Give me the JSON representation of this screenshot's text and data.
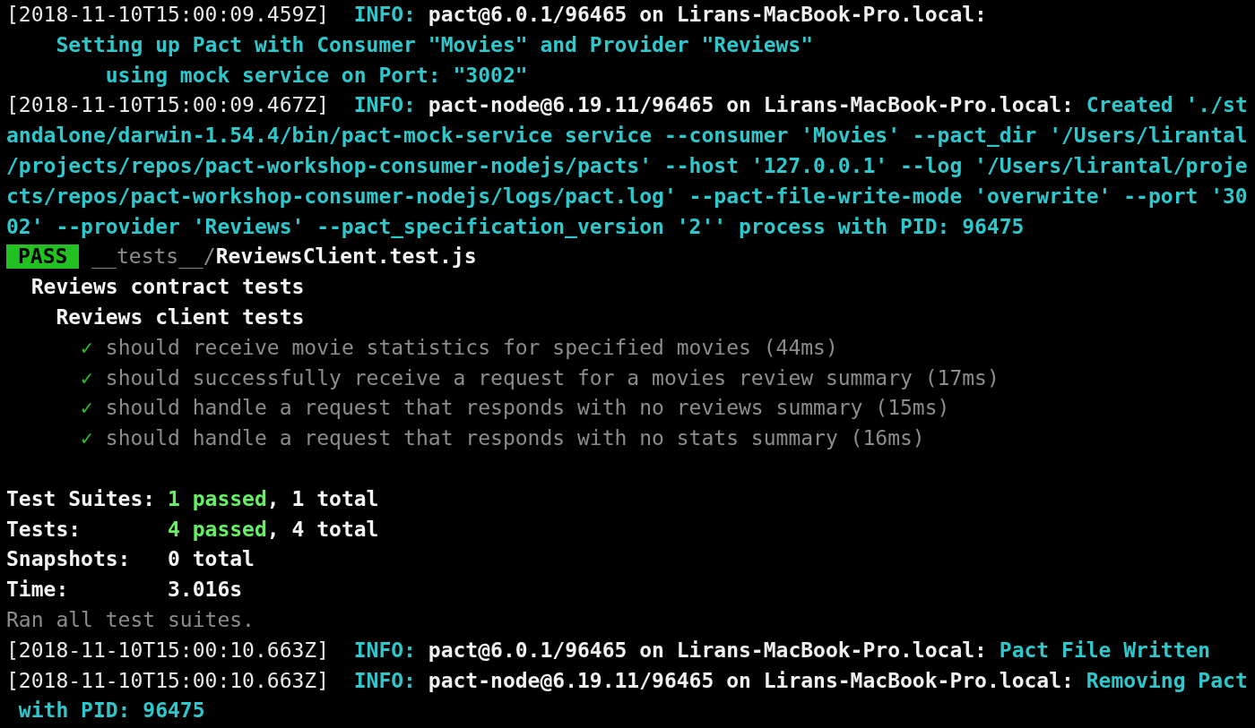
{
  "terminal": {
    "lines": [
      {
        "segments": [
          {
            "kind": "timestamp",
            "text": "[2018-11-10T15:00:09.459Z]"
          },
          {
            "kind": "level",
            "text": "  INFO:"
          },
          {
            "kind": "source",
            "text": " pact@6.0.1/96465 on Lirans-MacBook-Pro.local:"
          }
        ]
      },
      {
        "segments": [
          {
            "kind": "message",
            "text": "    Setting up Pact with Consumer \"Movies\" and Provider \"Reviews\""
          }
        ]
      },
      {
        "segments": [
          {
            "kind": "message",
            "text": "        using mock service on Port: \"3002\""
          }
        ]
      },
      {
        "segments": [
          {
            "kind": "timestamp",
            "text": "[2018-11-10T15:00:09.467Z]"
          },
          {
            "kind": "level",
            "text": "  INFO:"
          },
          {
            "kind": "source",
            "text": " pact-node@6.19.11/96465 on Lirans-MacBook-Pro.local:"
          },
          {
            "kind": "message",
            "text": " Created './st"
          }
        ]
      },
      {
        "segments": [
          {
            "kind": "message",
            "text": "andalone/darwin-1.54.4/bin/pact-mock-service service --consumer 'Movies' --pact_dir '/Users/lirantal"
          }
        ]
      },
      {
        "segments": [
          {
            "kind": "message",
            "text": "/projects/repos/pact-workshop-consumer-nodejs/pacts' --host '127.0.0.1' --log '/Users/lirantal/proje"
          }
        ]
      },
      {
        "segments": [
          {
            "kind": "message",
            "text": "cts/repos/pact-workshop-consumer-nodejs/logs/pact.log' --pact-file-write-mode 'overwrite' --port '30"
          }
        ]
      },
      {
        "segments": [
          {
            "kind": "message",
            "text": "02' --provider 'Reviews' --pact_specification_version '2'' process with PID: 96475"
          }
        ]
      },
      {
        "segments": [
          {
            "kind": "badge",
            "text": "PASS"
          },
          {
            "kind": "dim",
            "text": " __tests__/"
          },
          {
            "kind": "strong",
            "text": "ReviewsClient.test.js"
          }
        ]
      },
      {
        "segments": [
          {
            "kind": "strong",
            "text": "  Reviews contract tests"
          }
        ]
      },
      {
        "segments": [
          {
            "kind": "strong",
            "text": "    Reviews client tests"
          }
        ]
      },
      {
        "segments": [
          {
            "kind": "check",
            "text": "      ✓"
          },
          {
            "kind": "dim",
            "text": " should receive movie statistics for specified movies (44ms)"
          }
        ]
      },
      {
        "segments": [
          {
            "kind": "check",
            "text": "      ✓"
          },
          {
            "kind": "dim",
            "text": " should successfully receive a request for a movies review summary (17ms)"
          }
        ]
      },
      {
        "segments": [
          {
            "kind": "check",
            "text": "      ✓"
          },
          {
            "kind": "dim",
            "text": " should handle a request that responds with no reviews summary (15ms)"
          }
        ]
      },
      {
        "segments": [
          {
            "kind": "check",
            "text": "      ✓"
          },
          {
            "kind": "dim",
            "text": " should handle a request that responds with no stats summary (16ms)"
          }
        ]
      },
      {
        "gap_before": true,
        "segments": [
          {
            "kind": "strong",
            "text": "Test Suites: "
          },
          {
            "kind": "passed",
            "text": "1 passed"
          },
          {
            "kind": "strong",
            "text": ", 1 total"
          }
        ]
      },
      {
        "segments": [
          {
            "kind": "strong",
            "text": "Tests:       "
          },
          {
            "kind": "passed",
            "text": "4 passed"
          },
          {
            "kind": "strong",
            "text": ", 4 total"
          }
        ]
      },
      {
        "segments": [
          {
            "kind": "strong",
            "text": "Snapshots:   0 total"
          }
        ]
      },
      {
        "segments": [
          {
            "kind": "strong",
            "text": "Time:        3.016s"
          }
        ]
      },
      {
        "segments": [
          {
            "kind": "dim",
            "text": "Ran all test suites."
          }
        ]
      },
      {
        "segments": [
          {
            "kind": "timestamp",
            "text": "[2018-11-10T15:00:10.663Z]"
          },
          {
            "kind": "level",
            "text": "  INFO:"
          },
          {
            "kind": "source",
            "text": " pact@6.0.1/96465 on Lirans-MacBook-Pro.local:"
          },
          {
            "kind": "message",
            "text": " Pact File Written"
          }
        ]
      },
      {
        "segments": [
          {
            "kind": "timestamp",
            "text": "[2018-11-10T15:00:10.663Z]"
          },
          {
            "kind": "level",
            "text": "  INFO:"
          },
          {
            "kind": "source",
            "text": " pact-node@6.19.11/96465 on Lirans-MacBook-Pro.local:"
          },
          {
            "kind": "message",
            "text": " Removing Pact"
          }
        ]
      },
      {
        "segments": [
          {
            "kind": "message",
            "text": " with PID: 96475"
          }
        ]
      }
    ]
  }
}
